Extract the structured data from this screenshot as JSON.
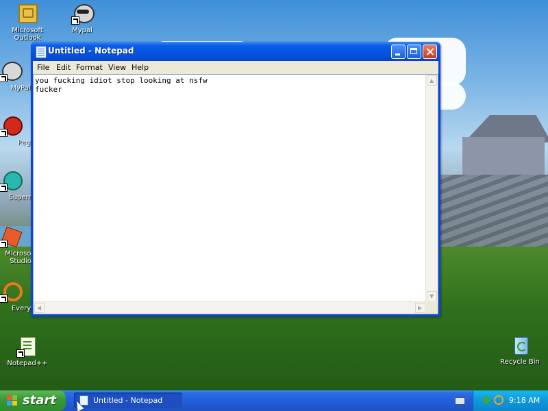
{
  "desktop": {
    "icons": [
      {
        "label": "Microsoft Outlook"
      },
      {
        "label": "Mypal"
      },
      {
        "label": "MyPal"
      },
      {
        "label": "Peg"
      },
      {
        "label": "Superr"
      },
      {
        "label": "Microsoft Studio"
      },
      {
        "label": "Everyt"
      },
      {
        "label": "Notepad++"
      },
      {
        "label": "Recycle Bin"
      }
    ]
  },
  "window": {
    "title": "Untitled - Notepad",
    "menu": [
      "File",
      "Edit",
      "Format",
      "View",
      "Help"
    ],
    "content": "you fucking idiot stop looking at nsfw\nfucker"
  },
  "taskbar": {
    "start_label": "start",
    "task_label": "Untitled - Notepad",
    "clock": "9:18 AM"
  },
  "colors": {
    "titlebar": "#0452e0",
    "start_button": "#3a9a36",
    "taskbar": "#245edb",
    "tray": "#0f97db"
  },
  "icons": [
    "outlook-icon",
    "mypal-icon",
    "peg-icon",
    "super-icon",
    "studio-icon",
    "everything-icon",
    "notepadpp-icon",
    "recycle-bin-icon",
    "notepad-icon",
    "windows-logo-icon",
    "keyboard-icon"
  ]
}
